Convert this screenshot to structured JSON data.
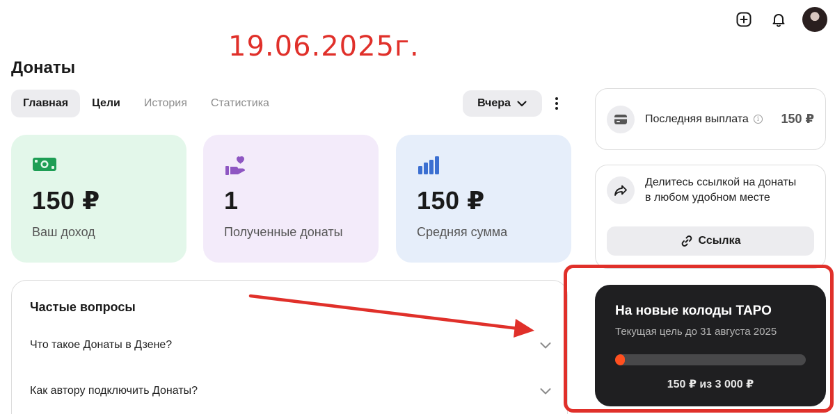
{
  "header": {
    "icons": [
      "plus-square-icon",
      "bell-icon",
      "avatar"
    ]
  },
  "annotation": {
    "date": "19.06.2025г.",
    "color": "#e0302a"
  },
  "page": {
    "title": "Донаты"
  },
  "tabs": [
    {
      "label": "Главная",
      "active": true
    },
    {
      "label": "Цели"
    },
    {
      "label": "История"
    },
    {
      "label": "Статистика"
    }
  ],
  "period": {
    "selected": "Вчера"
  },
  "stats": [
    {
      "value": "150 ₽",
      "label": "Ваш доход",
      "icon": "money-icon",
      "bg": "#e3f7ea"
    },
    {
      "value": "1",
      "label": "Полученные донаты",
      "icon": "donate-hand-icon",
      "bg": "#f3ebfa"
    },
    {
      "value": "150 ₽",
      "label": "Средняя сумма",
      "icon": "bar-chart-icon",
      "bg": "#e6eefa"
    }
  ],
  "faq": {
    "title": "Частые вопросы",
    "items": [
      {
        "question": "Что такое Донаты в Дзене?"
      },
      {
        "question": "Как автору подключить Донаты?"
      }
    ]
  },
  "payout": {
    "label": "Последняя выплата",
    "value": "150 ₽"
  },
  "share": {
    "text": "Делитесь ссылкой на донаты в любом удобном месте",
    "button": "Ссылка"
  },
  "goal": {
    "title": "На новые колоды ТАРО",
    "subtitle": "Текущая цель до 31 августа 2025",
    "amount": "150 ₽ из 3 000 ₽",
    "progress": 0.05,
    "accent": "#ff4f1f"
  }
}
